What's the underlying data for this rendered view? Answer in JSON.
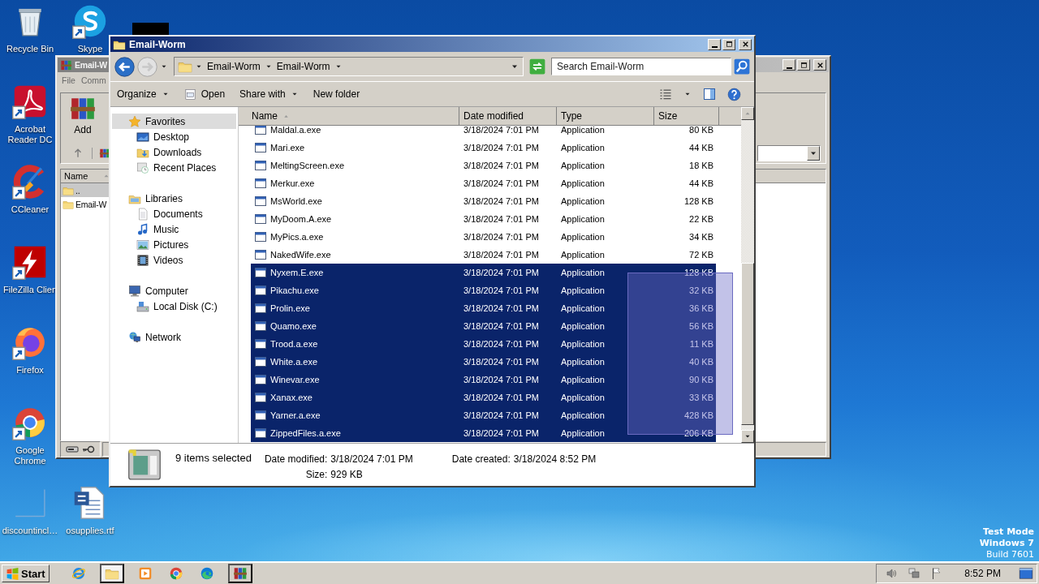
{
  "desktop": {
    "icons": [
      {
        "label": "Recycle Bin",
        "kind": "recycle",
        "shortcut": false
      },
      {
        "label": "Skype",
        "kind": "skype",
        "shortcut": true
      },
      {
        "label": "Acrobat Reader DC",
        "kind": "acrobat",
        "shortcut": true
      },
      {
        "label": "CCleaner",
        "kind": "ccleaner",
        "shortcut": true
      },
      {
        "label": "FileZilla Clien",
        "kind": "filezilla",
        "shortcut": true
      },
      {
        "label": "Firefox",
        "kind": "firefox",
        "shortcut": true
      },
      {
        "label": "Google Chrome",
        "kind": "chrome",
        "shortcut": true
      },
      {
        "label": "discountincl…",
        "kind": "blank",
        "shortcut": false
      },
      {
        "label": "osupplies.rtf",
        "kind": "word",
        "shortcut": false
      }
    ],
    "os_notice": [
      "Test Mode",
      "Windows 7",
      "Build 7601"
    ]
  },
  "archive_window": {
    "title": "Email-W",
    "menu": [
      "File",
      "Comm"
    ],
    "toolbar": [
      "Add"
    ],
    "column": {
      "label": "Name",
      "sorted": true
    },
    "rows": [
      {
        "name": "..",
        "selected": true
      },
      {
        "name": "Email-W",
        "selected": false
      }
    ]
  },
  "explorer": {
    "title": "Email-Worm",
    "breadcrumb": [
      "Email-Worm",
      "Email-Worm"
    ],
    "search": {
      "placeholder": "Search Email-Worm"
    },
    "commands": [
      {
        "label": "Organize",
        "kind": "menu"
      },
      {
        "label": "Open",
        "kind": "icon"
      },
      {
        "label": "Share with",
        "kind": "menu"
      },
      {
        "label": "New folder",
        "kind": "plain"
      }
    ],
    "navigation": [
      {
        "label": "Favorites",
        "kind": "star",
        "selected": true,
        "children": [
          {
            "label": "Desktop",
            "kind": "desktop",
            "selected": false
          },
          {
            "label": "Downloads",
            "kind": "downloads",
            "selected": false
          },
          {
            "label": "Recent Places",
            "kind": "recent",
            "selected": false
          }
        ]
      },
      {
        "label": "Libraries",
        "kind": "libraries",
        "selected": false,
        "children": [
          {
            "label": "Documents",
            "kind": "documents",
            "selected": false
          },
          {
            "label": "Music",
            "kind": "music",
            "selected": false
          },
          {
            "label": "Pictures",
            "kind": "pictures",
            "selected": false
          },
          {
            "label": "Videos",
            "kind": "videos",
            "selected": false
          }
        ]
      },
      {
        "label": "Computer",
        "kind": "computer",
        "selected": false,
        "children": [
          {
            "label": "Local Disk (C:)",
            "kind": "disk",
            "selected": false
          }
        ]
      },
      {
        "label": "Network",
        "kind": "network",
        "selected": false
      }
    ],
    "columns": [
      {
        "label": "Name",
        "sorted": true
      },
      {
        "label": "Date modified",
        "sorted": false
      },
      {
        "label": "Type",
        "sorted": false
      },
      {
        "label": "Size",
        "sorted": false
      }
    ],
    "files": [
      {
        "name": "Maldal.a.exe",
        "date": "3/18/2024 7:01 PM",
        "type": "Application",
        "size": "80 KB",
        "selected": false
      },
      {
        "name": "Mari.exe",
        "date": "3/18/2024 7:01 PM",
        "type": "Application",
        "size": "44 KB",
        "selected": false
      },
      {
        "name": "MeltingScreen.exe",
        "date": "3/18/2024 7:01 PM",
        "type": "Application",
        "size": "18 KB",
        "selected": false
      },
      {
        "name": "Merkur.exe",
        "date": "3/18/2024 7:01 PM",
        "type": "Application",
        "size": "44 KB",
        "selected": false
      },
      {
        "name": "MsWorld.exe",
        "date": "3/18/2024 7:01 PM",
        "type": "Application",
        "size": "128 KB",
        "selected": false
      },
      {
        "name": "MyDoom.A.exe",
        "date": "3/18/2024 7:01 PM",
        "type": "Application",
        "size": "22 KB",
        "selected": false
      },
      {
        "name": "MyPics.a.exe",
        "date": "3/18/2024 7:01 PM",
        "type": "Application",
        "size": "34 KB",
        "selected": false
      },
      {
        "name": "NakedWife.exe",
        "date": "3/18/2024 7:01 PM",
        "type": "Application",
        "size": "72 KB",
        "selected": false
      },
      {
        "name": "Nyxem.E.exe",
        "date": "3/18/2024 7:01 PM",
        "type": "Application",
        "size": "128 KB",
        "selected": true
      },
      {
        "name": "Pikachu.exe",
        "date": "3/18/2024 7:01 PM",
        "type": "Application",
        "size": "32 KB",
        "selected": true
      },
      {
        "name": "Prolin.exe",
        "date": "3/18/2024 7:01 PM",
        "type": "Application",
        "size": "36 KB",
        "selected": true
      },
      {
        "name": "Quamo.exe",
        "date": "3/18/2024 7:01 PM",
        "type": "Application",
        "size": "56 KB",
        "selected": true
      },
      {
        "name": "Trood.a.exe",
        "date": "3/18/2024 7:01 PM",
        "type": "Application",
        "size": "11 KB",
        "selected": true
      },
      {
        "name": "White.a.exe",
        "date": "3/18/2024 7:01 PM",
        "type": "Application",
        "size": "40 KB",
        "selected": true
      },
      {
        "name": "Winevar.exe",
        "date": "3/18/2024 7:01 PM",
        "type": "Application",
        "size": "90 KB",
        "selected": true
      },
      {
        "name": "Xanax.exe",
        "date": "3/18/2024 7:01 PM",
        "type": "Application",
        "size": "33 KB",
        "selected": true
      },
      {
        "name": "Yarner.a.exe",
        "date": "3/18/2024 7:01 PM",
        "type": "Application",
        "size": "428 KB",
        "selected": true
      },
      {
        "name": "ZippedFiles.a.exe",
        "date": "3/18/2024 7:01 PM",
        "type": "Application",
        "size": "206 KB",
        "selected": true
      }
    ],
    "marquee": true,
    "details": {
      "summary": "9 items selected",
      "fields": [
        {
          "label": "Date modified:",
          "value": "3/18/2024 7:01 PM"
        },
        {
          "label": "Date created:",
          "value": "3/18/2024 8:52 PM"
        },
        {
          "label": "Size:",
          "value": "929 KB"
        }
      ]
    }
  },
  "taskbar": {
    "start": "Start",
    "apps": [
      {
        "kind": "ie",
        "open": false,
        "active": false
      },
      {
        "kind": "explorer",
        "open": true,
        "active": true
      },
      {
        "kind": "media",
        "open": false,
        "active": false
      },
      {
        "kind": "chrome",
        "open": false,
        "active": false
      },
      {
        "kind": "edge",
        "open": false,
        "active": false
      },
      {
        "kind": "winrar",
        "open": true,
        "active": false
      }
    ],
    "clock": "8:52 PM"
  }
}
